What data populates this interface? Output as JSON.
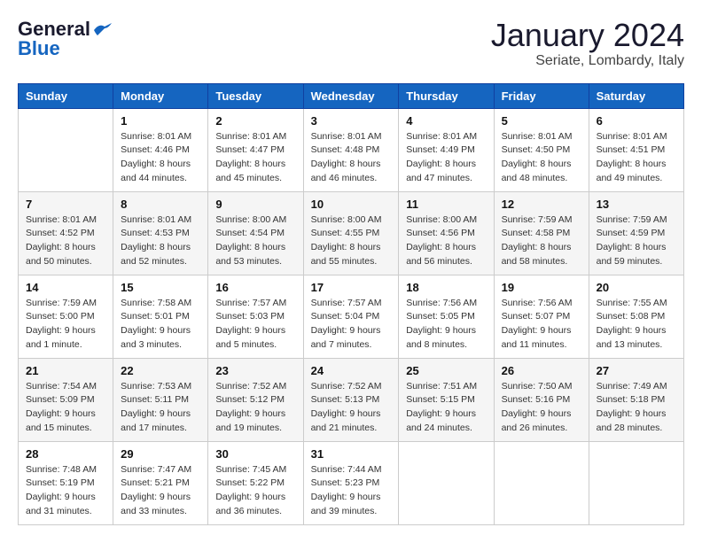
{
  "header": {
    "logo_general": "General",
    "logo_blue": "Blue",
    "title": "January 2024",
    "location": "Seriate, Lombardy, Italy"
  },
  "calendar": {
    "days_of_week": [
      "Sunday",
      "Monday",
      "Tuesday",
      "Wednesday",
      "Thursday",
      "Friday",
      "Saturday"
    ],
    "weeks": [
      [
        {
          "day": "",
          "info": ""
        },
        {
          "day": "1",
          "info": "Sunrise: 8:01 AM\nSunset: 4:46 PM\nDaylight: 8 hours\nand 44 minutes."
        },
        {
          "day": "2",
          "info": "Sunrise: 8:01 AM\nSunset: 4:47 PM\nDaylight: 8 hours\nand 45 minutes."
        },
        {
          "day": "3",
          "info": "Sunrise: 8:01 AM\nSunset: 4:48 PM\nDaylight: 8 hours\nand 46 minutes."
        },
        {
          "day": "4",
          "info": "Sunrise: 8:01 AM\nSunset: 4:49 PM\nDaylight: 8 hours\nand 47 minutes."
        },
        {
          "day": "5",
          "info": "Sunrise: 8:01 AM\nSunset: 4:50 PM\nDaylight: 8 hours\nand 48 minutes."
        },
        {
          "day": "6",
          "info": "Sunrise: 8:01 AM\nSunset: 4:51 PM\nDaylight: 8 hours\nand 49 minutes."
        }
      ],
      [
        {
          "day": "7",
          "info": "Sunrise: 8:01 AM\nSunset: 4:52 PM\nDaylight: 8 hours\nand 50 minutes."
        },
        {
          "day": "8",
          "info": "Sunrise: 8:01 AM\nSunset: 4:53 PM\nDaylight: 8 hours\nand 52 minutes."
        },
        {
          "day": "9",
          "info": "Sunrise: 8:00 AM\nSunset: 4:54 PM\nDaylight: 8 hours\nand 53 minutes."
        },
        {
          "day": "10",
          "info": "Sunrise: 8:00 AM\nSunset: 4:55 PM\nDaylight: 8 hours\nand 55 minutes."
        },
        {
          "day": "11",
          "info": "Sunrise: 8:00 AM\nSunset: 4:56 PM\nDaylight: 8 hours\nand 56 minutes."
        },
        {
          "day": "12",
          "info": "Sunrise: 7:59 AM\nSunset: 4:58 PM\nDaylight: 8 hours\nand 58 minutes."
        },
        {
          "day": "13",
          "info": "Sunrise: 7:59 AM\nSunset: 4:59 PM\nDaylight: 8 hours\nand 59 minutes."
        }
      ],
      [
        {
          "day": "14",
          "info": "Sunrise: 7:59 AM\nSunset: 5:00 PM\nDaylight: 9 hours\nand 1 minute."
        },
        {
          "day": "15",
          "info": "Sunrise: 7:58 AM\nSunset: 5:01 PM\nDaylight: 9 hours\nand 3 minutes."
        },
        {
          "day": "16",
          "info": "Sunrise: 7:57 AM\nSunset: 5:03 PM\nDaylight: 9 hours\nand 5 minutes."
        },
        {
          "day": "17",
          "info": "Sunrise: 7:57 AM\nSunset: 5:04 PM\nDaylight: 9 hours\nand 7 minutes."
        },
        {
          "day": "18",
          "info": "Sunrise: 7:56 AM\nSunset: 5:05 PM\nDaylight: 9 hours\nand 8 minutes."
        },
        {
          "day": "19",
          "info": "Sunrise: 7:56 AM\nSunset: 5:07 PM\nDaylight: 9 hours\nand 11 minutes."
        },
        {
          "day": "20",
          "info": "Sunrise: 7:55 AM\nSunset: 5:08 PM\nDaylight: 9 hours\nand 13 minutes."
        }
      ],
      [
        {
          "day": "21",
          "info": "Sunrise: 7:54 AM\nSunset: 5:09 PM\nDaylight: 9 hours\nand 15 minutes."
        },
        {
          "day": "22",
          "info": "Sunrise: 7:53 AM\nSunset: 5:11 PM\nDaylight: 9 hours\nand 17 minutes."
        },
        {
          "day": "23",
          "info": "Sunrise: 7:52 AM\nSunset: 5:12 PM\nDaylight: 9 hours\nand 19 minutes."
        },
        {
          "day": "24",
          "info": "Sunrise: 7:52 AM\nSunset: 5:13 PM\nDaylight: 9 hours\nand 21 minutes."
        },
        {
          "day": "25",
          "info": "Sunrise: 7:51 AM\nSunset: 5:15 PM\nDaylight: 9 hours\nand 24 minutes."
        },
        {
          "day": "26",
          "info": "Sunrise: 7:50 AM\nSunset: 5:16 PM\nDaylight: 9 hours\nand 26 minutes."
        },
        {
          "day": "27",
          "info": "Sunrise: 7:49 AM\nSunset: 5:18 PM\nDaylight: 9 hours\nand 28 minutes."
        }
      ],
      [
        {
          "day": "28",
          "info": "Sunrise: 7:48 AM\nSunset: 5:19 PM\nDaylight: 9 hours\nand 31 minutes."
        },
        {
          "day": "29",
          "info": "Sunrise: 7:47 AM\nSunset: 5:21 PM\nDaylight: 9 hours\nand 33 minutes."
        },
        {
          "day": "30",
          "info": "Sunrise: 7:45 AM\nSunset: 5:22 PM\nDaylight: 9 hours\nand 36 minutes."
        },
        {
          "day": "31",
          "info": "Sunrise: 7:44 AM\nSunset: 5:23 PM\nDaylight: 9 hours\nand 39 minutes."
        },
        {
          "day": "",
          "info": ""
        },
        {
          "day": "",
          "info": ""
        },
        {
          "day": "",
          "info": ""
        }
      ]
    ]
  }
}
